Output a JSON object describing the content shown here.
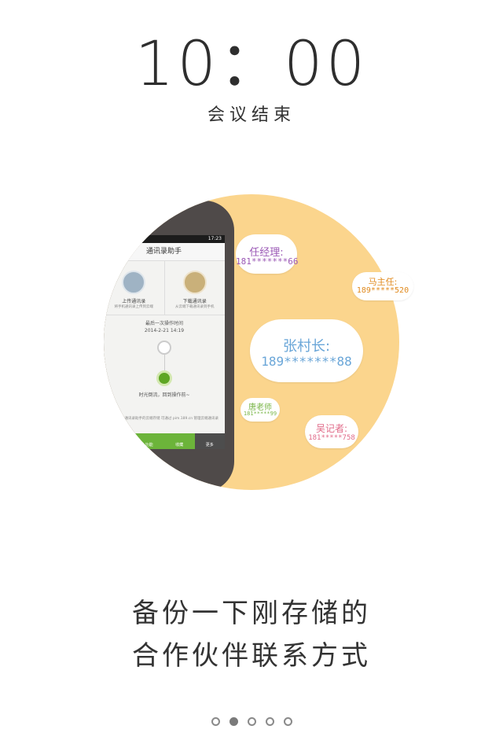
{
  "header": {
    "time": "10：00",
    "subtitle": "会议结束"
  },
  "colors": {
    "circle": "#fbd58d",
    "green": "#6cb43a",
    "phone": "#4f4a49"
  },
  "phone": {
    "status": "17:23",
    "app_title": "通讯录助手",
    "upload": {
      "label": "上传通讯录",
      "desc": "将手机通讯录上传到云端",
      "icon": "phone-upload-icon"
    },
    "download": {
      "label": "下载通讯录",
      "desc": "从云端下载通讯录到手机",
      "icon": "cloud-download-icon"
    },
    "last_op_label": "最后一次操作时间",
    "last_op_time": "2014-2-21   14:19",
    "rollback": "时光倒流，回到操作前~",
    "note": "号号需由本通讯录助手的云端存储 可通过 pim.189.cn 管理云端通讯录",
    "tabs": [
      {
        "label": "同步",
        "icon": "sync-icon"
      },
      {
        "label": "功能",
        "icon": "function-icon"
      },
      {
        "label": "收藏",
        "icon": "favorite-icon"
      },
      {
        "label": "更多",
        "icon": "more-icon"
      }
    ]
  },
  "contacts": [
    {
      "name": "任经理:",
      "number": "181*******66",
      "color": "#9b59b6"
    },
    {
      "name": "马主任:",
      "number": "189*****520",
      "color": "#e08a1e"
    },
    {
      "name": "张村长:",
      "number": "189*******88",
      "color": "#6aa6d8"
    },
    {
      "name": "唐老师",
      "number": "181*****99",
      "color": "#7ab648"
    },
    {
      "name": "吴记者:",
      "number": "181*****758",
      "color": "#e06a88"
    }
  ],
  "caption": {
    "line1": "备份一下刚存储的",
    "line2": "合作伙伴联系方式"
  },
  "pager": {
    "count": 5,
    "active": 2
  }
}
